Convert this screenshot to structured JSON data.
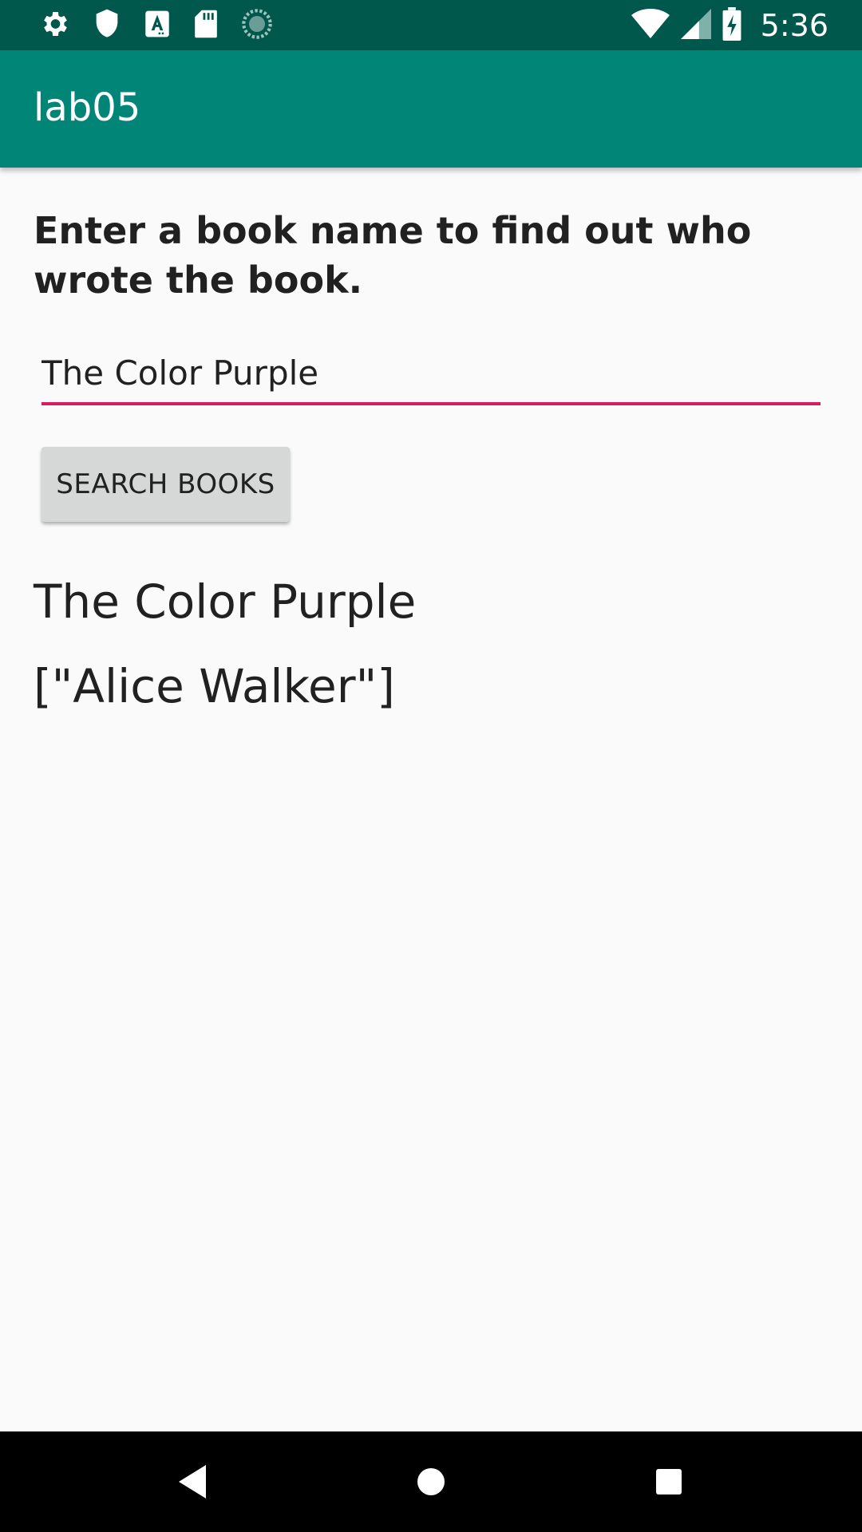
{
  "status_bar": {
    "time": "5:36",
    "left_icons": [
      "gear-icon",
      "shield-icon",
      "font-a-icon",
      "sd-card-icon",
      "loading-circle-icon"
    ],
    "right_icons": [
      "wifi-icon",
      "cell-signal-icon",
      "battery-charging-icon"
    ]
  },
  "app_bar": {
    "title": "lab05"
  },
  "main": {
    "instruction": "Enter a book name to find out who wrote the book.",
    "book_input": {
      "value": "The Color Purple",
      "placeholder": ""
    },
    "search_button_label": "SEARCH BOOKS",
    "result_title": "The Color Purple",
    "result_authors": "[\"Alice Walker\"]"
  },
  "nav_bar": {
    "icons": [
      "back-icon",
      "home-icon",
      "recents-icon"
    ]
  },
  "colors": {
    "status_bar": "#00574b",
    "app_bar": "#008577",
    "accent": "#d81b60",
    "background": "#fafafa",
    "button": "#d6d7d7"
  }
}
